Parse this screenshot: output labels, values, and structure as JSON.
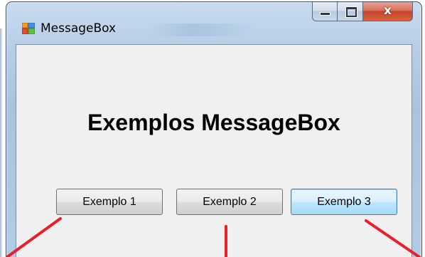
{
  "window": {
    "title": "MessageBox",
    "close_glyph": "x"
  },
  "form": {
    "heading": "Exemplos MessageBox",
    "buttons": [
      {
        "label": "Exemplo 1"
      },
      {
        "label": "Exemplo 2"
      },
      {
        "label": "Exemplo 3"
      }
    ]
  },
  "icons": {
    "app": "form-app-icon",
    "minimize": "minimize-icon",
    "maximize": "maximize-icon",
    "close": "close-icon"
  },
  "colors": {
    "annotation_arrow": "#e8202a",
    "client_background": "#f0f0f0",
    "close_button": "#c6452b",
    "focused_button_border": "#3c7fb1"
  }
}
